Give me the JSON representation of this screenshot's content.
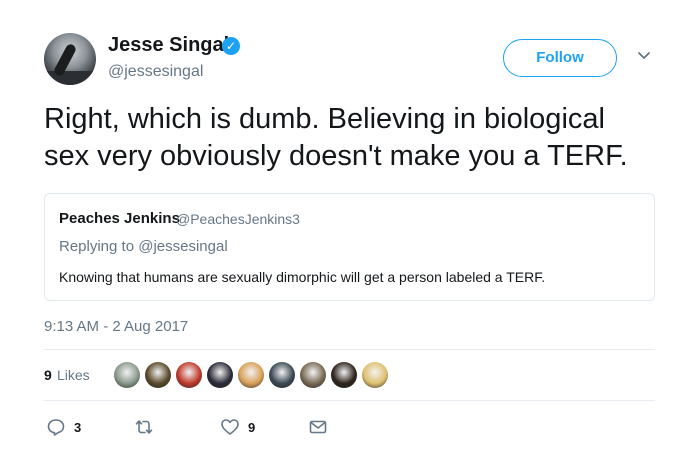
{
  "author": {
    "display_name": "Jesse Singal",
    "handle": "@jessesingal",
    "verified_icon": "verified-badge-icon"
  },
  "follow_button": "Follow",
  "tweet": {
    "text_line1": "Right, which is dumb. Believing in biological",
    "text_line2": "sex very obviously doesn't make you a TERF."
  },
  "quoted": {
    "name": "Peaches Jenkins",
    "handle": "@PeachesJenkins3",
    "replying_to": "Replying to @jessesingal",
    "text": "Knowing that humans are sexually dimorphic will get a person labeled a TERF."
  },
  "timestamp": "9:13 AM - 2 Aug 2017",
  "likes": {
    "count": "9",
    "label": "Likes"
  },
  "liker_avatars": [
    {
      "color": "#8a9a8c"
    },
    {
      "color": "#5a4a2a"
    },
    {
      "color": "#c0392b"
    },
    {
      "color": "#2c2c3a"
    },
    {
      "color": "#d9a15a"
    },
    {
      "color": "#3c4a55"
    },
    {
      "color": "#7a6a55"
    },
    {
      "color": "#2e241c"
    },
    {
      "color": "#e0c070"
    }
  ],
  "actions": {
    "reply_count": "3",
    "retweet_count": "",
    "like_count": "9"
  },
  "colors": {
    "accent": "#1da1f2",
    "muted": "#657786",
    "text": "#14171a",
    "border": "#e1e8ed"
  }
}
